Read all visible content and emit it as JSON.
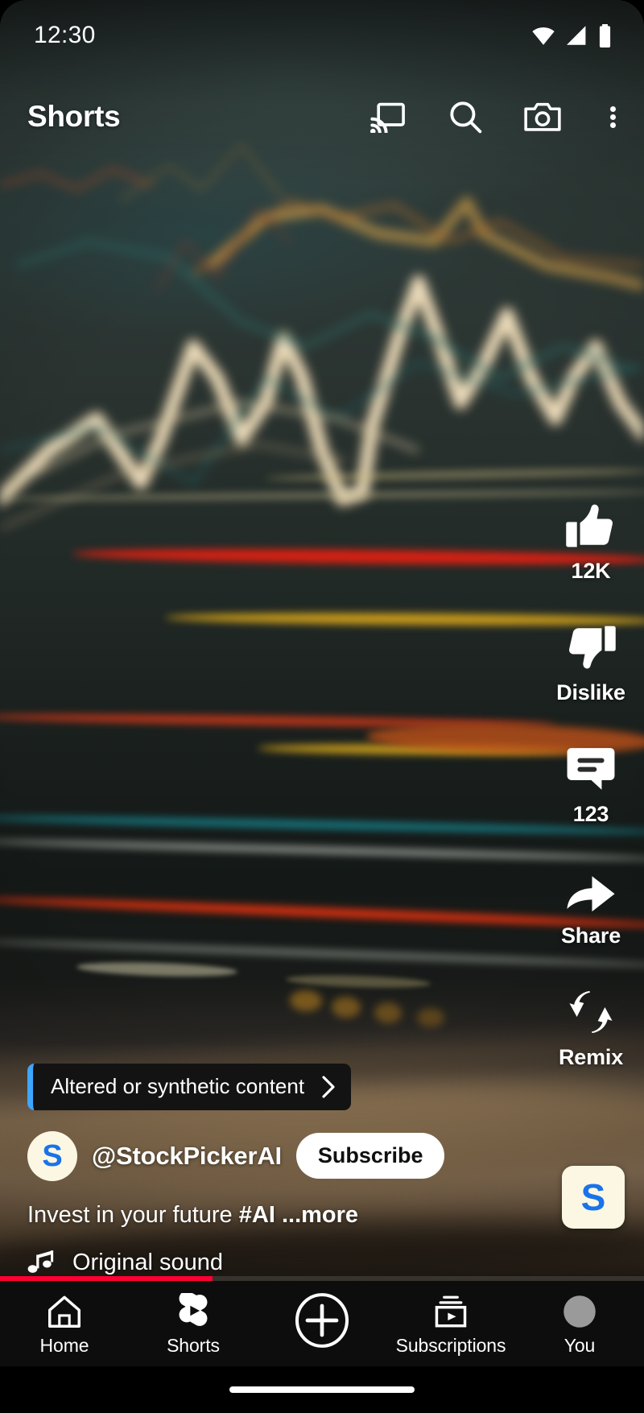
{
  "status_bar": {
    "time": "12:30",
    "icons": [
      "wifi-icon",
      "cellular-signal-icon",
      "battery-icon"
    ]
  },
  "top_bar": {
    "title": "Shorts",
    "actions": [
      {
        "name": "cast-icon",
        "label": "Cast"
      },
      {
        "name": "search-icon",
        "label": "Search"
      },
      {
        "name": "camera-icon",
        "label": "Camera"
      },
      {
        "name": "more-options-icon",
        "label": "More options"
      }
    ]
  },
  "action_rail": {
    "like": {
      "icon": "thumbs-up-icon",
      "label": "12K"
    },
    "dislike": {
      "icon": "thumbs-down-icon",
      "label": "Dislike"
    },
    "comment": {
      "icon": "comment-bubble-icon",
      "label": "123"
    },
    "share": {
      "icon": "share-arrow-icon",
      "label": "Share"
    },
    "remix": {
      "icon": "remix-arrows-icon",
      "label": "Remix"
    },
    "sound_thumbnail": {
      "icon": "sound-thumbnail",
      "letter": "S"
    }
  },
  "video_meta": {
    "synthetic_banner": {
      "text": "Altered or synthetic content",
      "chevron": "chevron-right-icon",
      "accent_color": "#3ea6ff"
    },
    "channel": {
      "avatar_letter": "S",
      "handle": "@StockPickerAI",
      "subscribe_label": "Subscribe"
    },
    "caption": {
      "plain": "Invest in your future ",
      "hashtag": "#AI",
      "more": "...more"
    },
    "sound": {
      "icon": "music-note-icon",
      "label": "Original sound"
    }
  },
  "progress": {
    "percent": 33,
    "color": "#ff0033"
  },
  "bottom_nav": {
    "items": [
      {
        "name": "nav-home",
        "label": "Home",
        "icon": "home-icon",
        "active": false
      },
      {
        "name": "nav-shorts",
        "label": "Shorts",
        "icon": "shorts-icon",
        "active": true
      },
      {
        "name": "nav-create",
        "label": "",
        "icon": "plus-circle-icon",
        "active": false
      },
      {
        "name": "nav-subscriptions",
        "label": "Subscriptions",
        "icon": "subscriptions-icon",
        "active": false
      },
      {
        "name": "nav-you",
        "label": "You",
        "icon": "account-avatar-icon",
        "active": false
      }
    ]
  },
  "colors": {
    "accent_blue": "#3ea6ff",
    "brand_red": "#ff0033",
    "avatar_cream": "#fbf7e3",
    "avatar_letter_blue": "#1a73e8"
  }
}
